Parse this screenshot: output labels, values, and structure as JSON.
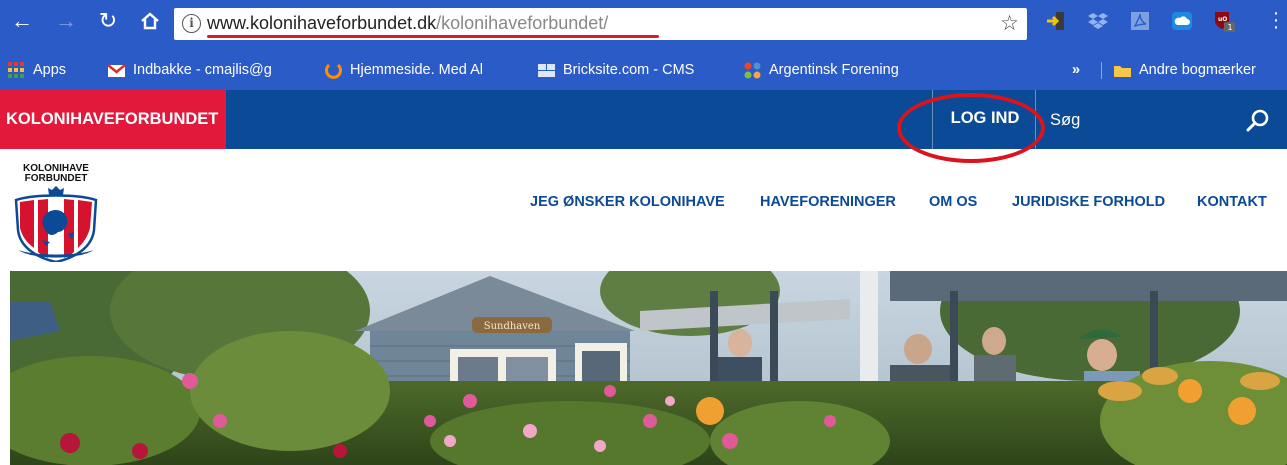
{
  "browser": {
    "url_domain": "www.kolonihaveforbundet.dk",
    "url_path": "/kolonihaveforbundet/",
    "extension_badge": "1",
    "bookmarks": [
      {
        "label": "Apps"
      },
      {
        "label": "Indbakke - cmajlis@g"
      },
      {
        "label": "Hjemmeside. Med Al"
      },
      {
        "label": "Bricksite.com - CMS"
      },
      {
        "label": "Argentinsk Forening"
      }
    ],
    "overflow_label": "»",
    "other_bookmarks": "Andre bogmærker"
  },
  "site": {
    "brand_tab": "KOLONIHAVEFORBUNDET",
    "login_label": "LOG IND",
    "search_placeholder": "Søg",
    "logo_text_line1": "KOLONIHAVE",
    "logo_text_line2": "FORBUNDET",
    "nav": [
      {
        "label": "JEG ØNSKER KOLONIHAVE"
      },
      {
        "label": "HAVEFORENINGER"
      },
      {
        "label": "OM OS"
      },
      {
        "label": "JURIDISKE FORHOLD"
      },
      {
        "label": "KONTAKT"
      }
    ],
    "hero_sign": "Sundhaven"
  },
  "colors": {
    "chrome_blue": "#2b5bc7",
    "site_blue": "#0a4a96",
    "brand_red": "#e3193b",
    "annotation_red": "#e0182a"
  },
  "icons": [
    "back-icon",
    "forward-icon",
    "reload-icon",
    "home-icon",
    "info-icon",
    "star-icon",
    "search-icon",
    "apps-icon",
    "gmail-icon",
    "folder-icon"
  ]
}
